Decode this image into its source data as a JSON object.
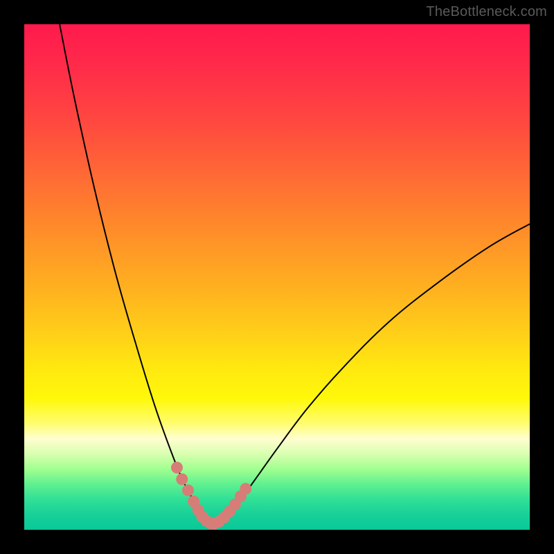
{
  "watermark": "TheBottleneck.com",
  "chart_data": {
    "type": "line",
    "title": "",
    "xlabel": "",
    "ylabel": "",
    "xlim": [
      0,
      100
    ],
    "ylim": [
      0,
      100
    ],
    "grid": false,
    "legend": false,
    "series": [
      {
        "name": "left_curve",
        "x": [
          7,
          10,
          14,
          18,
          22,
          26,
          30,
          32,
          34,
          35.2,
          36,
          36.8,
          37.5
        ],
        "y": [
          100,
          85,
          67,
          51,
          37,
          24,
          13,
          8.5,
          5,
          3.5,
          2.5,
          1.8,
          1.2
        ]
      },
      {
        "name": "right_curve",
        "x": [
          37.5,
          38.5,
          40,
          42,
          45,
          50,
          56,
          63,
          72,
          82,
          92,
          100
        ],
        "y": [
          1.2,
          1.6,
          2.8,
          5,
          9,
          16,
          24,
          32,
          41,
          49,
          56,
          60.5
        ]
      }
    ],
    "markers": {
      "name": "highlighted_points",
      "color": "#d77d78",
      "points": [
        {
          "x": 30.2,
          "y": 12.3
        },
        {
          "x": 31.2,
          "y": 10.0
        },
        {
          "x": 32.4,
          "y": 7.8
        },
        {
          "x": 33.5,
          "y": 5.6
        },
        {
          "x": 34.4,
          "y": 3.9
        },
        {
          "x": 35.2,
          "y": 2.6
        },
        {
          "x": 36.0,
          "y": 1.8
        },
        {
          "x": 36.8,
          "y": 1.3
        },
        {
          "x": 37.5,
          "y": 1.2
        },
        {
          "x": 38.5,
          "y": 1.6
        },
        {
          "x": 39.5,
          "y": 2.4
        },
        {
          "x": 40.6,
          "y": 3.6
        },
        {
          "x": 41.7,
          "y": 5.0
        },
        {
          "x": 42.8,
          "y": 6.6
        },
        {
          "x": 43.8,
          "y": 8.1
        }
      ]
    }
  }
}
